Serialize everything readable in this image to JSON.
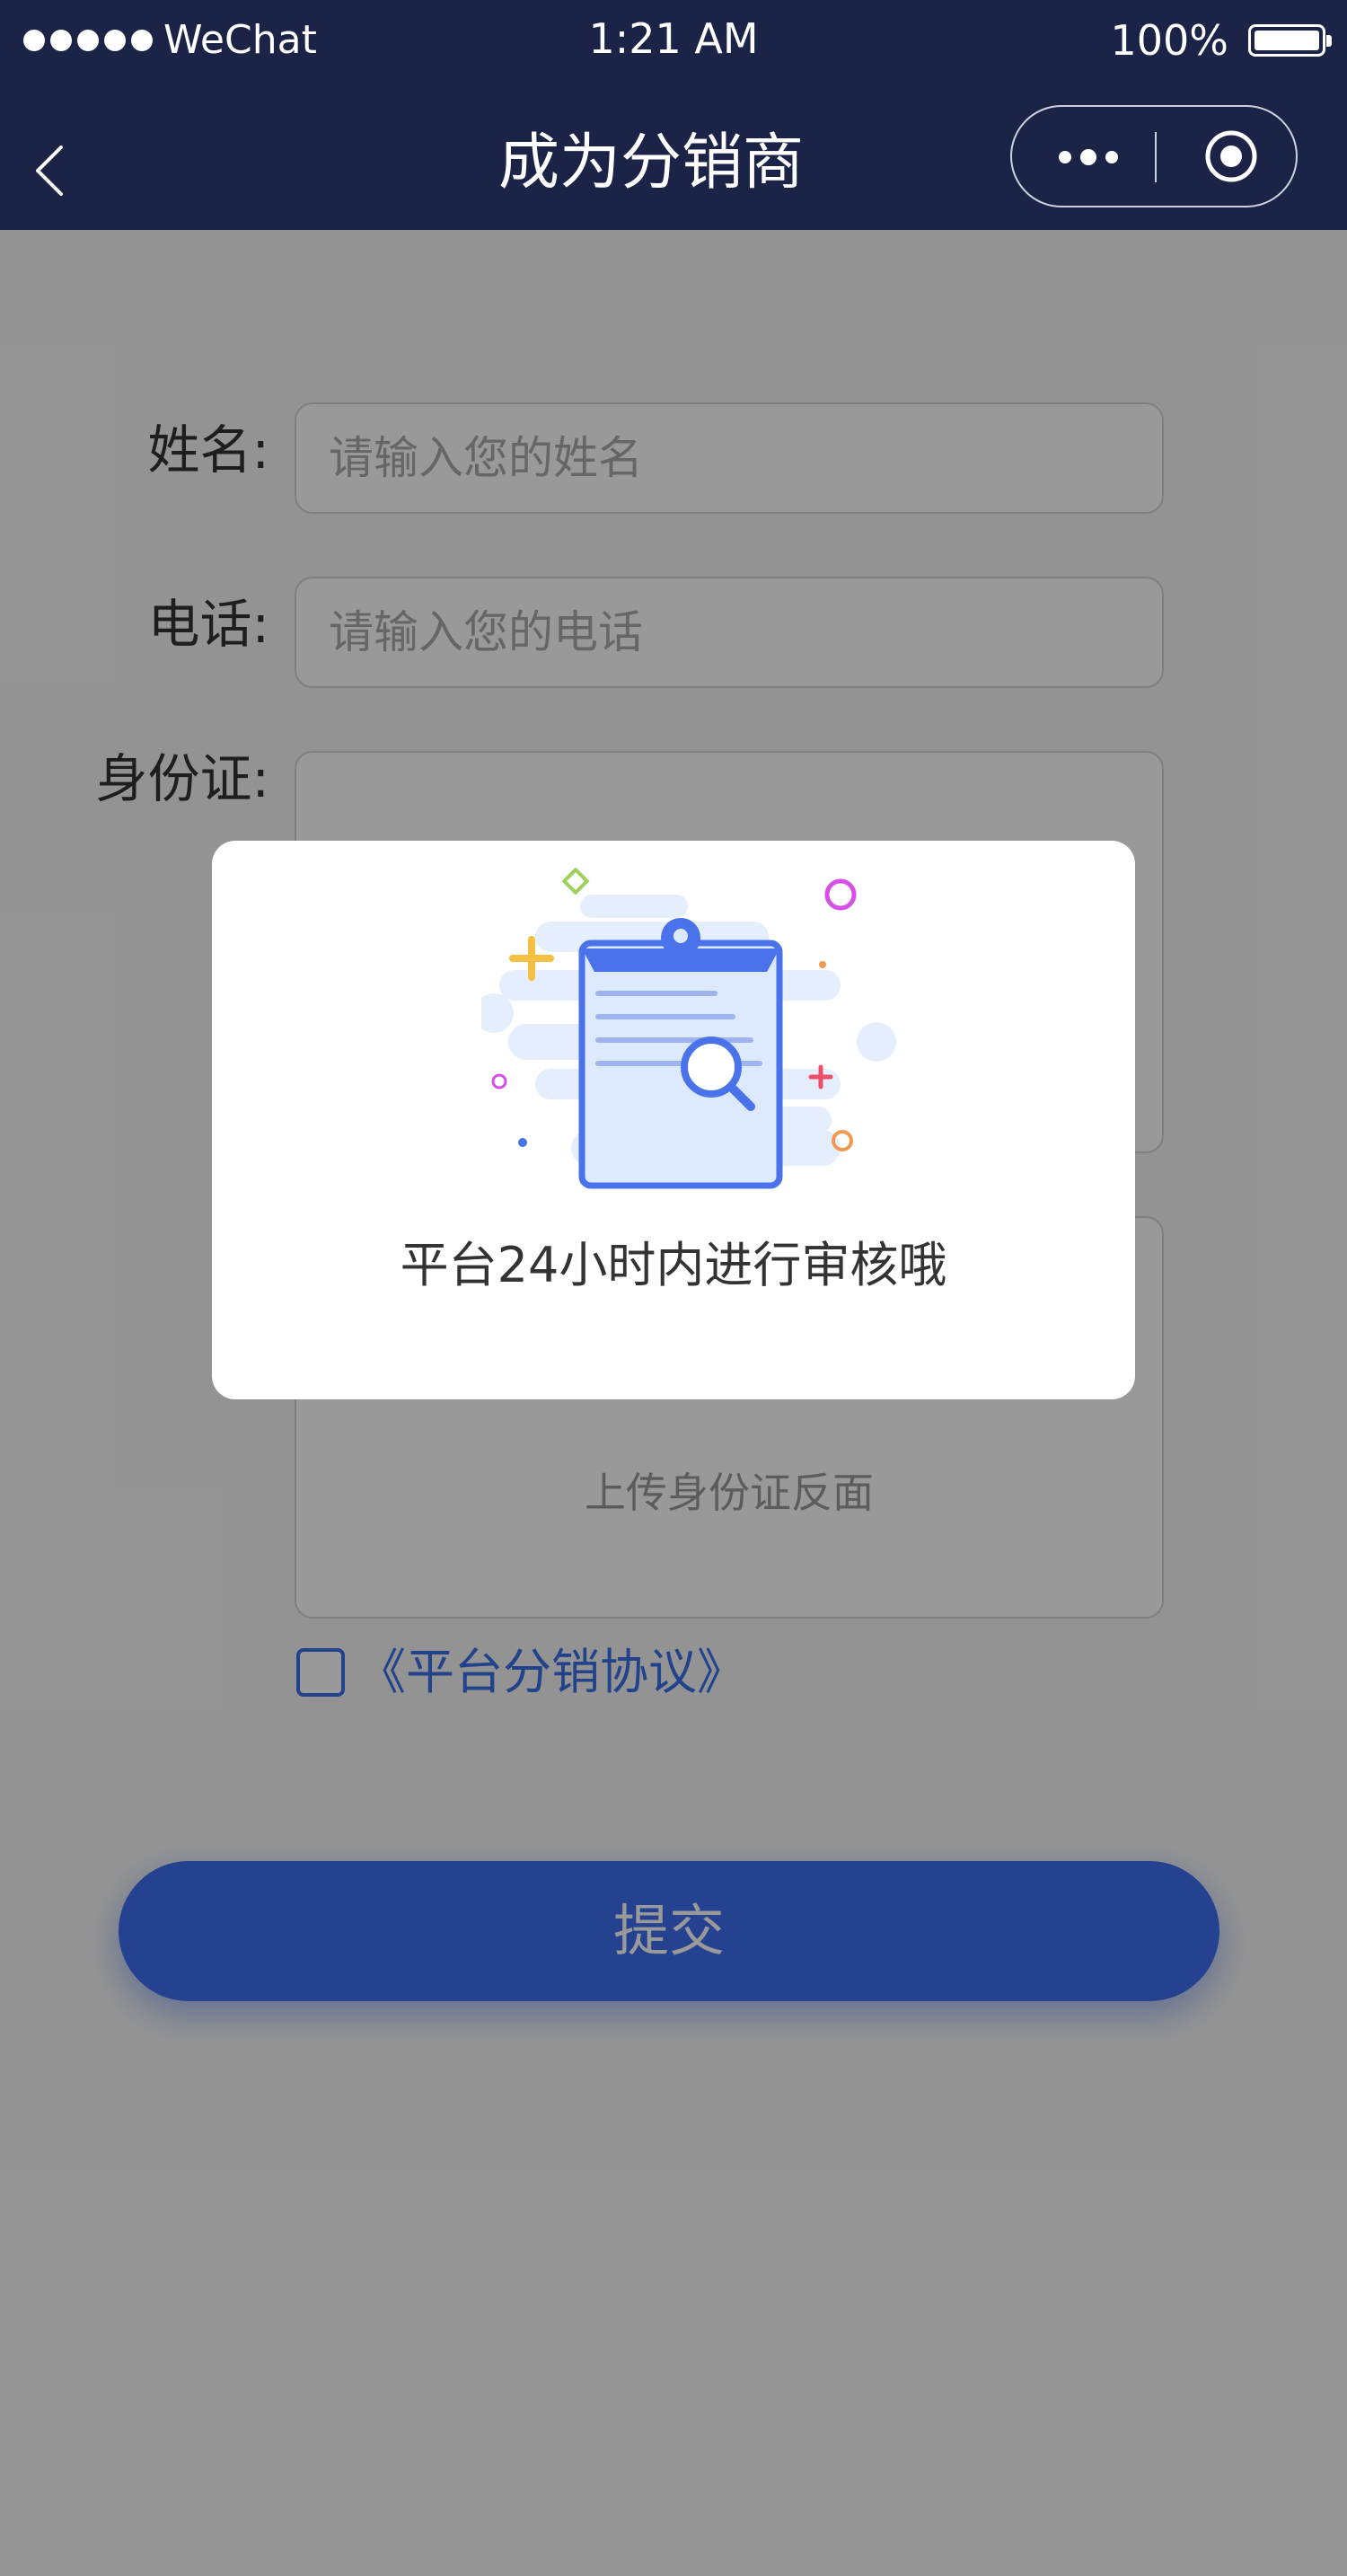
{
  "status_bar": {
    "carrier": "WeChat",
    "time": "1:21 AM",
    "battery": "100%"
  },
  "nav": {
    "title": "成为分销商"
  },
  "form": {
    "name_label": "姓名:",
    "name_placeholder": "请输入您的姓名",
    "phone_label": "电话:",
    "phone_placeholder": "请输入您的电话",
    "id_label": "身份证:",
    "id_back_text": "上传身份证反面",
    "agreement_link": "《平台分销协议》",
    "agreement_checked": false,
    "submit_label": "提交"
  },
  "modal": {
    "message": "平台24小时内进行审核哦"
  },
  "colors": {
    "nav_bg": "#1b2346",
    "accent": "#3e6ef2",
    "link": "#3a6ee8"
  }
}
